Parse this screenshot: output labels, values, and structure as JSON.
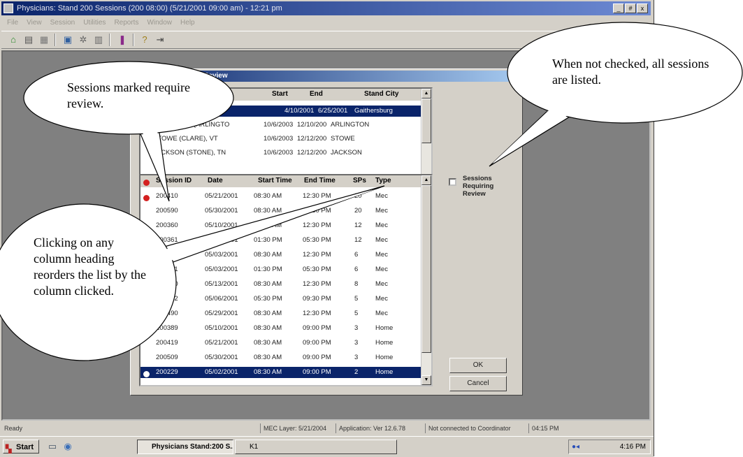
{
  "window": {
    "title": "Physicians: Stand 200 Sessions (200 08:00) (5/21/2001 09:00 am) - 12:21 pm",
    "controls": [
      "_",
      "#",
      "x"
    ]
  },
  "menubar": [
    "File",
    "View",
    "Session",
    "Utilities",
    "Reports",
    "Window",
    "Help"
  ],
  "toolbar": {
    "icons": [
      "home-icon",
      "clipboard-icon",
      "chart-icon",
      "monitor-icon",
      "gear-icon",
      "calendar-icon",
      "book-icon",
      "help-icon",
      "exit-icon"
    ]
  },
  "dialog": {
    "title": "Sessions Requiring Review",
    "stand_list": {
      "headers": {
        "start": "Start",
        "end": "End",
        "stand_city": "Stand City"
      },
      "rows": [
        {
          "name": "",
          "start": "4/10/2001",
          "end": "6/25/2001",
          "city": "Gaithersburg"
        },
        {
          "name": "ARLINGTON (ARLINGTO",
          "start": "10/6/2003",
          "end": "12/10/200",
          "city": "ARLINGTON"
        },
        {
          "name": "STOWE (CLARE), VT",
          "start": "10/6/2003",
          "end": "12/12/200",
          "city": "STOWE"
        },
        {
          "name": "JACKSON (STONE), TN",
          "start": "10/6/2003",
          "end": "12/12/200",
          "city": "JACKSON"
        }
      ]
    },
    "session_list": {
      "headers": {
        "session_id": "Session ID",
        "date": "Date",
        "start_time": "Start Time",
        "end_time": "End Time",
        "sps": "SPs",
        "type": "Type"
      },
      "rows": [
        {
          "id": "200410",
          "date": "05/21/2001",
          "start": "08:30 AM",
          "end": "12:30 PM",
          "sps": "20",
          "type": "Mec"
        },
        {
          "id": "200590",
          "date": "05/30/2001",
          "start": "08:30 AM",
          "end": "12:30 PM",
          "sps": "20",
          "type": "Mec"
        },
        {
          "id": "200360",
          "date": "05/10/2001",
          "start": "08:30 AM",
          "end": "12:30 PM",
          "sps": "12",
          "type": "Mec"
        },
        {
          "id": "200361",
          "date": "05/10/2001",
          "start": "01:30 PM",
          "end": "05:30 PM",
          "sps": "12",
          "type": "Mec"
        },
        {
          "id": "200230",
          "date": "05/03/2001",
          "start": "08:30 AM",
          "end": "12:30 PM",
          "sps": "6",
          "type": "Mec"
        },
        {
          "id": "200231",
          "date": "05/03/2001",
          "start": "01:30 PM",
          "end": "05:30 PM",
          "sps": "6",
          "type": "Mec"
        },
        {
          "id": "200380",
          "date": "05/13/2001",
          "start": "08:30 AM",
          "end": "12:30 PM",
          "sps": "8",
          "type": "Mec"
        },
        {
          "id": "200262",
          "date": "05/06/2001",
          "start": "05:30 PM",
          "end": "09:30 PM",
          "sps": "5",
          "type": "Mec"
        },
        {
          "id": "200490",
          "date": "05/29/2001",
          "start": "08:30 AM",
          "end": "12:30 PM",
          "sps": "5",
          "type": "Mec"
        },
        {
          "id": "200389",
          "date": "05/10/2001",
          "start": "08:30 AM",
          "end": "09:00 PM",
          "sps": "3",
          "type": "Home"
        },
        {
          "id": "200419",
          "date": "05/21/2001",
          "start": "08:30 AM",
          "end": "09:00 PM",
          "sps": "3",
          "type": "Home"
        },
        {
          "id": "200509",
          "date": "05/30/2001",
          "start": "08:30 AM",
          "end": "09:00 PM",
          "sps": "3",
          "type": "Home"
        },
        {
          "id": "200229",
          "date": "05/02/2001",
          "start": "08:30 AM",
          "end": "09:00 PM",
          "sps": "2",
          "type": "Home"
        }
      ]
    },
    "checkbox_label": "Sessions Requiring Review",
    "ok_label": "OK",
    "cancel_label": "Cancel"
  },
  "statusbar": {
    "ready": "Ready",
    "mec_layer": "MEC Layer: 5/21/2004",
    "application": "Application: Ver 12.6.78",
    "connection": "Not connected to Coordinator",
    "time": "04:15 PM"
  },
  "taskbar": {
    "start_label": "Start",
    "active_task": "Physicians Stand:200 S...",
    "second_task": "K1",
    "clock": "4:16 PM"
  },
  "callouts": {
    "review": "Sessions marked require review.",
    "not_checked": "When not checked, all sessions are listed.",
    "column_heading": "Clicking on any column heading reorders the list by the column clicked."
  }
}
